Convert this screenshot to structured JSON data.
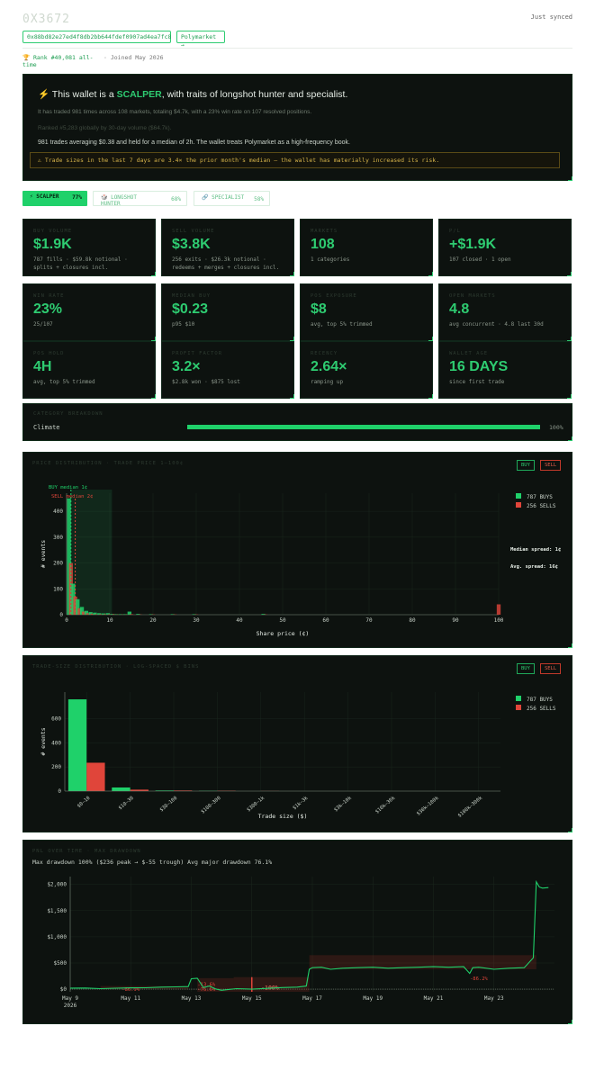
{
  "header": {
    "title": "0X3672",
    "synced": "Just synced",
    "address": "0x88bd82e27ed4f8db2bb644fdef0907ad4ea7fc8",
    "platform_link": "Polymarket →",
    "rank": "🏆 Rank #40,081 all-time",
    "joined": "· Joined May 2026"
  },
  "summary": {
    "prefix": "⚡ This wallet is a ",
    "type": "SCALPER",
    "suffix": ", with traits of longshot hunter and specialist.",
    "line1": "It has traded 981 times across 108 markets, totaling $4.7k, with a 23% win rate on 107 resolved positions.",
    "line2": "Ranked #5,283 globally by 30-day volume ($64.7k).",
    "line3": "981 trades averaging $0.38 and held for a median of 2h. The wallet treats Polymarket as a high-frequency book.",
    "warning": "⚠ Trade sizes in the last 7 days are 3.4× the prior month's median — the wallet has materially increased its risk."
  },
  "tabs": [
    {
      "label": "⚡ SCALPER",
      "pct": "77%"
    },
    {
      "label": "🎲 LONGSHOT HUNTER",
      "pct": "68%"
    },
    {
      "label": "🔗 SPECIALIST",
      "pct": "58%"
    }
  ],
  "cards": [
    {
      "label": "BUY VOLUME",
      "value": "$1.9K",
      "sub": "787 fills · $59.8k notional · splits + closures incl."
    },
    {
      "label": "SELL VOLUME",
      "value": "$3.8K",
      "sub": "256 exits · $26.3k notional · redeems + merges + closures incl."
    },
    {
      "label": "MARKETS",
      "value": "108",
      "sub": "1 categories"
    },
    {
      "label": "P/L",
      "value": "+$1.9K",
      "sub": "107 closed · 1 open"
    },
    {
      "label": "WIN RATE",
      "value": "23%",
      "sub": "25/107"
    },
    {
      "label": "MEDIAN BUY",
      "value": "$0.23",
      "sub": "p95 $10"
    },
    {
      "label": "POS EXPOSURE",
      "value": "$8",
      "sub": "avg, top 5% trimmed"
    },
    {
      "label": "OPEN MARKETS",
      "value": "4.8",
      "sub": "avg concurrent · 4.8 last 30d"
    },
    {
      "label": "POS HOLD",
      "value": "4H",
      "sub": "avg, top 5% trimmed"
    },
    {
      "label": "PROFIT FACTOR",
      "value": "3.2×",
      "sub": "$2.8k won · $875 lost"
    },
    {
      "label": "RECENCY",
      "value": "2.64×",
      "sub": "ramping up"
    },
    {
      "label": "WALLET AGE",
      "value": "16 DAYS",
      "sub": "since first trade"
    }
  ],
  "category": {
    "label": "CATEGORY BREAKDOWN",
    "name": "Climate",
    "pct": "100%",
    "share": 1.0
  },
  "buttons": {
    "buy": "BUY",
    "sell": "SELL"
  },
  "colors": {
    "buy": "#1fd16a",
    "sell": "#e0453a",
    "bg": "#0d120f"
  },
  "chart_data": [
    {
      "type": "bar",
      "title": "PRICE DISTRIBUTION · TRADE PRICE 1–100¢",
      "xlabel": "Share price (¢)",
      "ylabel": "# events",
      "xlim": [
        0,
        100
      ],
      "ylim": [
        0,
        470
      ],
      "xticks": [
        "0",
        "10",
        "20",
        "30",
        "40",
        "50",
        "60",
        "70",
        "80",
        "90",
        "100"
      ],
      "yticks": [
        "0",
        "100",
        "200",
        "300",
        "400"
      ],
      "annotations": {
        "buy_median": "BUY median 1¢",
        "sell_median": "SELL median 2¢",
        "median_spread": "Median spread: 1¢",
        "avg_spread": "Avg. spread:   16¢"
      },
      "legend": [
        "787 BUYS",
        "256 SELLS"
      ],
      "x": [
        1,
        2,
        3,
        4,
        5,
        6,
        7,
        8,
        9,
        10,
        11,
        12,
        13,
        14,
        15,
        17,
        20,
        25,
        30,
        46,
        100
      ],
      "series": [
        {
          "name": "787 BUYS",
          "values": [
            450,
            120,
            60,
            30,
            15,
            10,
            8,
            6,
            5,
            6,
            3,
            2,
            2,
            2,
            12,
            3,
            2,
            2,
            2,
            3,
            0
          ]
        },
        {
          "name": "256 SELLS",
          "values": [
            200,
            70,
            25,
            12,
            6,
            4,
            2,
            2,
            2,
            2,
            2,
            1,
            1,
            1,
            2,
            1,
            1,
            1,
            1,
            1,
            40
          ]
        }
      ]
    },
    {
      "type": "bar",
      "title": "TRADE-SIZE DISTRIBUTION · LOG-SPACED $ BINS",
      "xlabel": "Trade size ($)",
      "ylabel": "# events",
      "ylim": [
        0,
        820
      ],
      "yticks": [
        "0",
        "200",
        "400",
        "600"
      ],
      "categories": [
        "$0–10",
        "$10–30",
        "$30–100",
        "$100–300",
        "$300–1k",
        "$1k–3k",
        "$3k–10k",
        "$10k–30k",
        "$30k–100k",
        "$100k–300k"
      ],
      "legend": [
        "787 BUYS",
        "256 SELLS"
      ],
      "series": [
        {
          "name": "787 BUYS",
          "values": [
            760,
            30,
            5,
            2,
            0,
            0,
            0,
            0,
            0,
            0
          ]
        },
        {
          "name": "256 SELLS",
          "values": [
            235,
            12,
            5,
            3,
            1,
            0,
            0,
            0,
            0,
            0
          ]
        }
      ]
    },
    {
      "type": "line",
      "title": "PNL OVER TIME · MAX DRAWDOWN",
      "subtitle": "Max drawdown 100% ($236 peak → $-55 trough)   Avg major drawdown 76.1%",
      "yticks": [
        "$0",
        "$500",
        "$1,000",
        "$1,500",
        "$2,000"
      ],
      "ylim": [
        -50,
        2150
      ],
      "xticks": [
        "May 9\n2026",
        "May 11",
        "May 13",
        "May 15",
        "May 17",
        "May 19",
        "May 21",
        "May 23"
      ],
      "drawdown_labels": [
        "-86.9%",
        "-13.6%",
        "-76.6%",
        "-100%",
        "-86.2%"
      ],
      "x_days": [
        9,
        9.5,
        10,
        10.5,
        11,
        11.5,
        12,
        12.5,
        12.9,
        13.0,
        13.2,
        13.4,
        13.6,
        13.8,
        14.0,
        14.5,
        15.0,
        15.5,
        16.0,
        16.5,
        16.8,
        16.9,
        17.0,
        17.3,
        17.6,
        18.0,
        18.5,
        19.0,
        19.5,
        20.0,
        20.5,
        21.0,
        21.5,
        22.0,
        22.2,
        22.3,
        22.5,
        23.0,
        23.5,
        24.0,
        24.3,
        24.4,
        24.5,
        24.6,
        24.8
      ],
      "pnl": [
        20,
        22,
        10,
        18,
        25,
        28,
        40,
        45,
        50,
        200,
        210,
        30,
        60,
        5,
        -20,
        10,
        0,
        15,
        30,
        40,
        60,
        380,
        410,
        420,
        380,
        400,
        410,
        420,
        400,
        410,
        420,
        430,
        420,
        430,
        300,
        410,
        420,
        380,
        400,
        410,
        600,
        2050,
        1950,
        1930,
        1940
      ]
    }
  ]
}
